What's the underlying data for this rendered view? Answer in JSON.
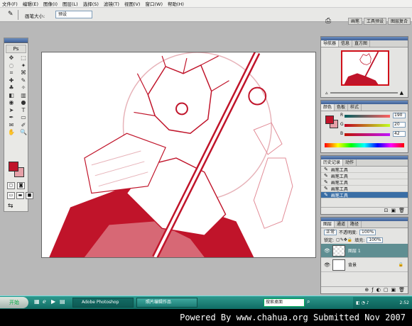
{
  "menu": {
    "items": [
      "文件(F)",
      "编辑(E)",
      "图像(I)",
      "图层(L)",
      "选择(S)",
      "滤镜(T)",
      "视图(V)",
      "窗口(W)",
      "帮助(H)"
    ]
  },
  "options": {
    "label": "画笔大小:",
    "preset_value": "预设",
    "right_tabs": [
      "画笔",
      "工具预设",
      "图层复合"
    ]
  },
  "toolbox": {
    "logo": "Ps",
    "tool_icons": [
      "move-icon",
      "marquee-icon",
      "lasso-icon",
      "magic-wand-icon",
      "crop-icon",
      "slice-icon",
      "healing-icon",
      "brush-icon",
      "stamp-icon",
      "history-brush-icon",
      "eraser-icon",
      "gradient-icon",
      "blur-icon",
      "dodge-icon",
      "path-select-icon",
      "type-icon",
      "pen-icon",
      "shape-icon",
      "notes-icon",
      "eyedropper-icon",
      "hand-icon",
      "zoom-icon"
    ],
    "tool_glyphs": [
      "✥",
      "⬚",
      "◌",
      "✦",
      "⌗",
      "⌘",
      "✚",
      "✎",
      "♣",
      "✧",
      "◧",
      "▥",
      "◉",
      "●",
      "➤",
      "T",
      "✒",
      "▭",
      "✉",
      "✐",
      "✋",
      "🔍"
    ],
    "foreground_color": "#c0142a",
    "background_color": "#e6a0a8"
  },
  "navigator": {
    "tabs": [
      "导航器",
      "信息",
      "直方图"
    ],
    "zoom_out": "▵",
    "zoom_in": "▲"
  },
  "color_panel": {
    "tabs": [
      "颜色",
      "色板",
      "样式"
    ],
    "channels": [
      {
        "label": "R",
        "value": "190"
      },
      {
        "label": "G",
        "value": "20"
      },
      {
        "label": "B",
        "value": "42"
      }
    ]
  },
  "history": {
    "tabs": [
      "历史记录",
      "动作"
    ],
    "items": [
      "画笔工具",
      "画笔工具",
      "画笔工具",
      "画笔工具",
      "画笔工具"
    ],
    "selected_index": 4,
    "footer_icons": [
      "⊡",
      "▣",
      "🗑"
    ]
  },
  "layers": {
    "tabs": [
      "图层",
      "通道",
      "路径"
    ],
    "blend_mode": "正常",
    "opacity_label": "不透明度:",
    "opacity_value": "100%",
    "lock_label": "锁定:",
    "fill_label": "填充:",
    "fill_value": "100%",
    "list": [
      {
        "name": "图层 1",
        "selected": true
      },
      {
        "name": "背景",
        "selected": false
      }
    ],
    "footer_icons": [
      "⊕",
      "ƒ",
      "◐",
      "▢",
      "▣",
      "🗑"
    ]
  },
  "taskbar": {
    "start_label": "开始",
    "windows": [
      "Adobe Photoshop",
      "照片编辑作品"
    ],
    "search_placeholder": "搜索桌面",
    "clock": "2:52"
  },
  "footer": {
    "credit": "Powered By www.chahua.org  Submitted Nov 2007"
  }
}
